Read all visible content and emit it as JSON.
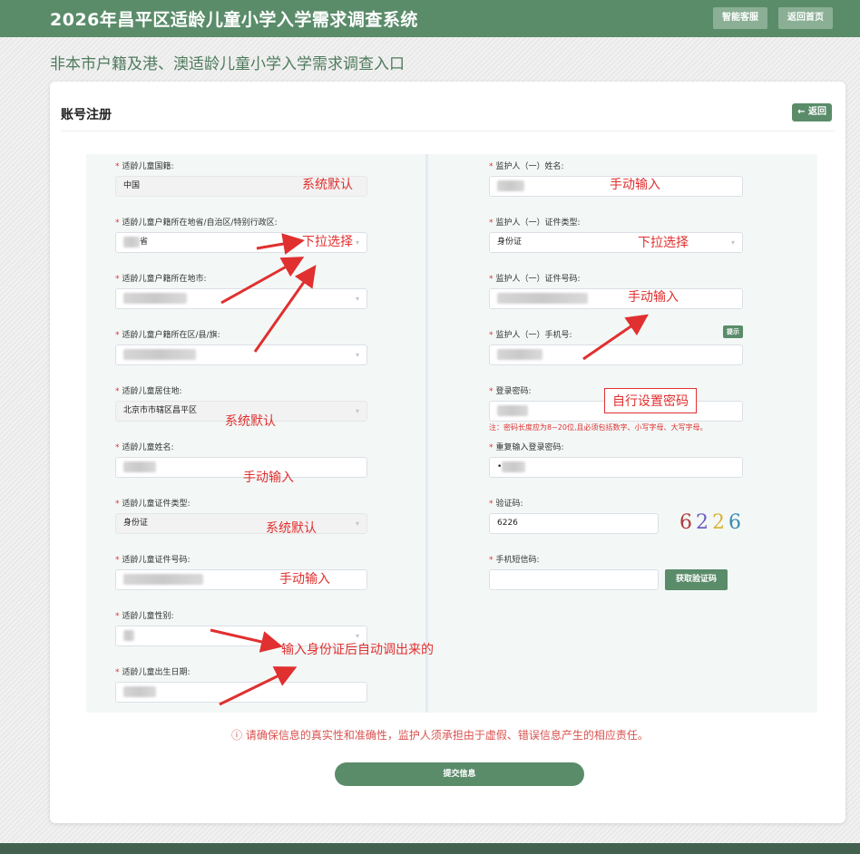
{
  "header": {
    "title": "2026年昌平区适龄儿童小学入学需求调查系统",
    "btn_service": "智能客服",
    "btn_home": "返回首页"
  },
  "subtitle": "非本市户籍及港、澳适龄儿童小学入学需求调查入口",
  "card": {
    "title": "账号注册",
    "back": "返回"
  },
  "left": {
    "nationality_label": "适龄儿童国籍:",
    "nationality_value": "中国",
    "province_label": "适龄儿童户籍所在地省/自治区/特别行政区:",
    "province_value": "省",
    "city_label": "适龄儿童户籍所在地市:",
    "district_label": "适龄儿童户籍所在区/县/旗:",
    "residence_label": "适龄儿童居住地:",
    "residence_value": "北京市市辖区昌平区",
    "name_label": "适龄儿童姓名:",
    "idtype_label": "适龄儿童证件类型:",
    "idtype_value": "身份证",
    "idno_label": "适龄儿童证件号码:",
    "gender_label": "适龄儿童性别:",
    "birth_label": "适龄儿童出生日期:"
  },
  "right": {
    "guardian_name_label": "监护人（一）姓名:",
    "guardian_idtype_label": "监护人（一）证件类型:",
    "guardian_idtype_value": "身份证",
    "guardian_idno_label": "监护人（一）证件号码:",
    "guardian_phone_label": "监护人（一）手机号:",
    "hint": "提示",
    "password_label": "登录密码:",
    "password_note": "注：密码长度应为8~20位,且必须包括数字、小写字母、大写字母。",
    "repassword_label": "重复输入登录密码:",
    "repassword_value": "•",
    "captcha_label": "验证码:",
    "captcha_input": "6226",
    "captcha_chars": [
      "6",
      "2",
      "2",
      "6"
    ],
    "sms_label": "手机短信码:",
    "sms_button": "获取验证码"
  },
  "warning": "ⓘ 请确保信息的真实性和准确性，监护人须承担由于虚假、错误信息产生的相应责任。",
  "submit": "提交信息",
  "annotations": {
    "a1": "系统默认",
    "a2": "下拉选择",
    "a3": "系统默认",
    "a4": "手动输入",
    "a5": "系统默认",
    "a6": "手动输入",
    "a7": "输入身份证后自动调出来的",
    "a8": "手动输入",
    "a9": "下拉选择",
    "a10": "手动输入",
    "a11": "自行设置密码"
  },
  "colors": {
    "primary": "#5a8c6a",
    "annotation": "#e0302f",
    "captcha": [
      "#b23a3a",
      "#6f5ec2",
      "#d8b53a",
      "#3a8bb2"
    ]
  }
}
